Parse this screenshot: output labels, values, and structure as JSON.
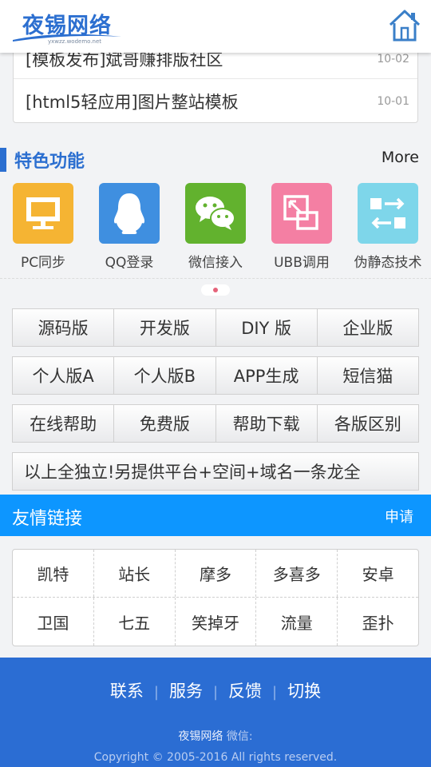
{
  "header": {
    "logo_text": "夜锡网络",
    "logo_sub": "yxwzz.wodemo.net"
  },
  "news": [
    {
      "title": "[模板发布]斌哥赚排版社区",
      "date": "10-02"
    },
    {
      "title": "[html5轻应用]图片整站模板",
      "date": "10-01"
    }
  ],
  "features": {
    "title": "特色功能",
    "more": "More",
    "items": [
      {
        "label": "PC同步",
        "color": "#f5b433",
        "icon": "monitor-icon"
      },
      {
        "label": "QQ登录",
        "color": "#3f8fe0",
        "icon": "qq-penguin-icon"
      },
      {
        "label": "微信接入",
        "color": "#62b22e",
        "icon": "wechat-icon"
      },
      {
        "label": "UBB调用",
        "color": "#f47fa3",
        "icon": "resize-icon"
      },
      {
        "label": "伪静态技术",
        "color": "#7ed6ea",
        "icon": "swap-icon"
      }
    ]
  },
  "versions": [
    [
      "源码版",
      "开发版",
      "DIY 版",
      "企业版"
    ],
    [
      "个人版A",
      "个人版B",
      "APP生成",
      "短信猫"
    ],
    [
      "在线帮助",
      "免费版",
      "帮助下载",
      "各版区别"
    ],
    [
      "以上全独立!另提供平台+空间+域名一条龙全"
    ]
  ],
  "links": {
    "title": "友情链接",
    "apply": "申请",
    "row1": [
      "凯特",
      "站长",
      "摩多",
      "多喜多",
      "安卓"
    ],
    "row2": [
      "卫国",
      "七五",
      "笑掉牙",
      "流量",
      "歪扑"
    ]
  },
  "footer": {
    "nav": [
      "联系",
      "服务",
      "反馈",
      "切换"
    ],
    "site": "夜锡网络",
    "wechat": "微信:",
    "copyright": "Copyright © 2005-2016 All rights reserved."
  },
  "colors": {
    "accent": "#2c6fd0",
    "links_bar": "#0d96ff",
    "footer": "#2b6dd3"
  }
}
